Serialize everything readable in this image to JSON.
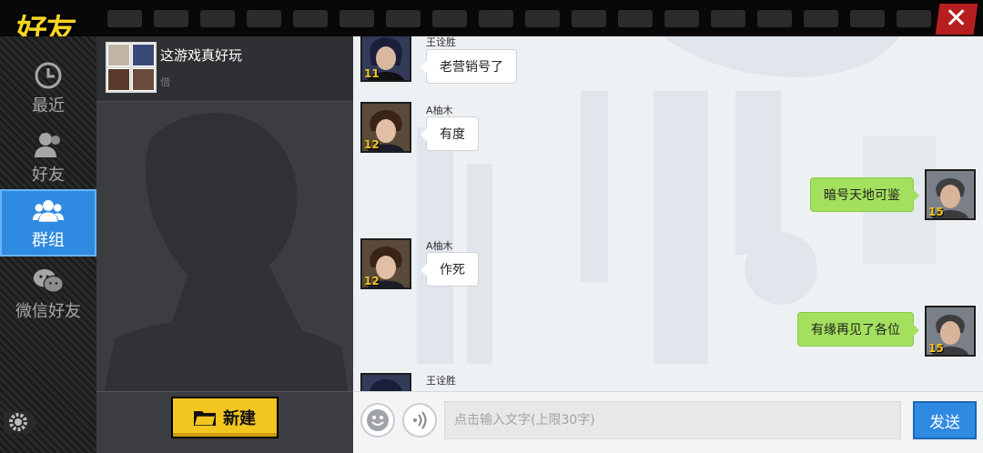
{
  "app": {
    "title": "好友",
    "close_glyph": "✕"
  },
  "colors": {
    "accent_blue": "#2f8ae2",
    "accent_yellow": "#f3c51f",
    "bubble_green": "#a3e05d",
    "close_red": "#b61f1f"
  },
  "nav": {
    "items": [
      {
        "label": "最近",
        "icon": "clock-icon"
      },
      {
        "label": "好友",
        "icon": "person-icon"
      },
      {
        "label": "群组",
        "icon": "group-icon",
        "active": true
      },
      {
        "label": "微信好友",
        "icon": "wechat-icon"
      }
    ],
    "settings_icon": "gear-icon"
  },
  "groups": {
    "items": [
      {
        "name": "这游戏真好玩",
        "sub": "借"
      }
    ],
    "new_button_label": "新建",
    "new_button_icon": "folder-icon"
  },
  "chat": {
    "messages": [
      {
        "side": "left",
        "sender": "王诠胜",
        "text": "老营销号了",
        "level": "11"
      },
      {
        "side": "left",
        "sender": "A柚木",
        "text": "有度",
        "level": "12"
      },
      {
        "side": "right",
        "sender": "",
        "text": "暗号天地可鉴",
        "level": "15"
      },
      {
        "side": "left",
        "sender": "A柚木",
        "text": "作死",
        "level": "12"
      },
      {
        "side": "right",
        "sender": "",
        "text": "有缘再见了各位",
        "level": "15"
      },
      {
        "side": "left",
        "sender": "王诠胜",
        "text": "",
        "level": ""
      }
    ]
  },
  "input": {
    "placeholder": "点击输入文字(上限30字)",
    "value": "",
    "emoji_icon": "emoji-icon",
    "voice_icon": "voice-icon",
    "send_label": "发送"
  }
}
